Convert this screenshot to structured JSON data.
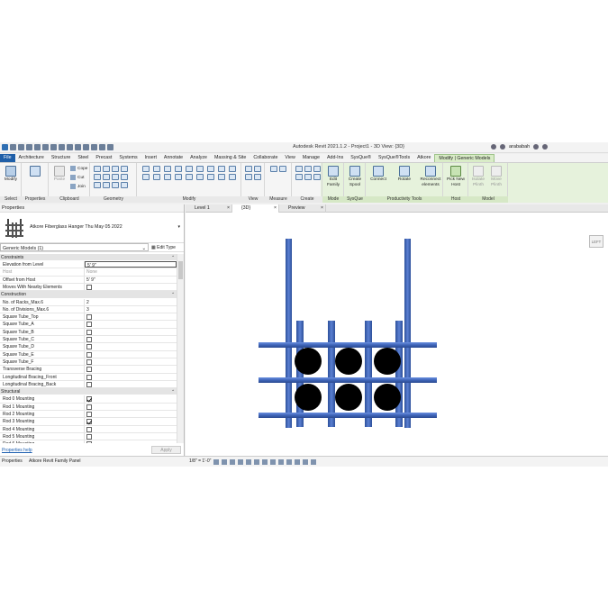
{
  "titlebar": {
    "title": "Autodesk Revit 2021.1.2 - Project1 - 3D View: {3D}",
    "user": "arababah"
  },
  "tabs": [
    "File",
    "Architecture",
    "Structure",
    "Steel",
    "Precast",
    "Systems",
    "Insert",
    "Annotate",
    "Analyze",
    "Massing & Site",
    "Collaborate",
    "View",
    "Manage",
    "Add-Ins",
    "SysQue®",
    "SysQue®Tools",
    "Atkore",
    "Modify | Generic Models"
  ],
  "ribbon": {
    "modify_label": "Modify",
    "paste_label": "Paste",
    "cope_label": "Cope",
    "cut_label": "Cut",
    "join_label": "Join",
    "edit_family_label": "Edit Family",
    "create_spool_label": "Create Spool",
    "connect_label": "Connect",
    "rotate_label": "Rotate",
    "reconnect_label": "Reconnect elements",
    "pick_host_label": "Pick New Host",
    "isolate_label": "Isolate Plinth",
    "move_label": "Move Plinth",
    "panels": {
      "select": "Select",
      "properties": "Properties",
      "clipboard": "Clipboard",
      "geometry": "Geometry",
      "modify": "Modify",
      "view": "View",
      "measure": "Measure",
      "create": "Create",
      "mode": "Mode",
      "sysque": "SysQue",
      "productivity": "Productivity Tools",
      "host": "Host",
      "model": "Model"
    }
  },
  "properties": {
    "title": "Properties",
    "type_name": "Atkore Fiberglass Hanger Thu May 05 2022",
    "filter": "Generic Models (1)",
    "edit_type": "Edit Type",
    "groups": [
      {
        "name": "Constraints",
        "rows": [
          {
            "k": "Elevation from Level",
            "v": "5'  9\"",
            "boxed": true
          },
          {
            "k": "Host",
            "v": "None",
            "grey": true
          },
          {
            "k": "Offset from Host",
            "v": "5'  9\""
          },
          {
            "k": "Moves With Nearby Elements",
            "check": false
          }
        ]
      },
      {
        "name": "Construction",
        "rows": [
          {
            "k": "No. of Racks_Max.6",
            "v": "2"
          },
          {
            "k": "No. of Divisions_Max.6",
            "v": "3"
          },
          {
            "k": "Square Tube_Top",
            "check": false
          },
          {
            "k": "Square Tube_A",
            "check": false
          },
          {
            "k": "Square Tube_B",
            "check": false
          },
          {
            "k": "Square Tube_C",
            "check": false
          },
          {
            "k": "Square Tube_D",
            "check": false
          },
          {
            "k": "Square Tube_E",
            "check": false
          },
          {
            "k": "Square Tube_F",
            "check": false
          },
          {
            "k": "Transverse Bracing",
            "check": false
          },
          {
            "k": "Longitudinal Bracing_Front",
            "check": false
          },
          {
            "k": "Longitudinal Bracing_Back",
            "check": false
          }
        ]
      },
      {
        "name": "Structural",
        "rows": [
          {
            "k": "Rod 0 Mounting",
            "check": true
          },
          {
            "k": "Rod 1 Mounting",
            "check": false
          },
          {
            "k": "Rod 2 Mounting",
            "check": false
          },
          {
            "k": "Rod 3 Mounting",
            "check": true
          },
          {
            "k": "Rod 4 Mounting",
            "check": false
          },
          {
            "k": "Rod 5 Mounting",
            "check": false
          },
          {
            "k": "Rod 6 Mounting",
            "check": false
          }
        ]
      }
    ],
    "help": "Properties help",
    "apply": "Apply"
  },
  "view_tabs": [
    {
      "label": "Level 1",
      "active": false
    },
    {
      "label": "{3D}",
      "active": true
    },
    {
      "label": "Preview",
      "active": false
    }
  ],
  "status": {
    "left": "Properties",
    "browser": "Atkore Revit Family Panel",
    "scale": "1/8\" = 1'-0\""
  },
  "viewcube_label": "LEFT",
  "colors": {
    "accent": "#1f5fa8",
    "context_tab": "#d9ecc7",
    "model_blue": "#3e64b8",
    "pipe": "#000000"
  }
}
